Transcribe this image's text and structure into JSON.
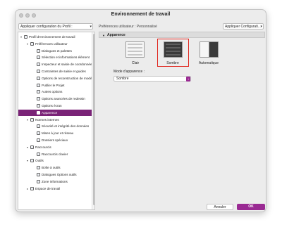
{
  "window": {
    "title": "Environnement de travail"
  },
  "toolbar": {
    "left_select": "Appliquer configuration du Profil :",
    "pref_label": "Préférences utilisateur : Personnalisé",
    "right_select": "Appliquer Configurati..."
  },
  "tree": [
    {
      "label": "Profil d'environnement de travail",
      "level": 0,
      "chevron": "v",
      "icon": "folder-icon"
    },
    {
      "label": "Préférences utilisateur",
      "level": 1,
      "chevron": "v",
      "icon": "folder-icon"
    },
    {
      "label": "Dialogues et palettes",
      "level": 2,
      "icon": "dialog-icon"
    },
    {
      "label": "Sélection et informations élément",
      "level": 2,
      "icon": "selection-icon"
    },
    {
      "label": "Inspecteur et saisie de coordonnées",
      "level": 2,
      "icon": "inspector-icon"
    },
    {
      "label": "Contraintes de saisie et guides",
      "level": 2,
      "icon": "constraint-icon"
    },
    {
      "label": "Options de reconstruction de modèle",
      "level": 2,
      "icon": "rebuild-icon"
    },
    {
      "label": "Publier le Projet",
      "level": 2,
      "icon": "publish-icon"
    },
    {
      "label": "Autres options",
      "level": 2,
      "icon": "options-icon"
    },
    {
      "label": "Options avancées de redessin",
      "level": 2,
      "icon": "redraw-icon"
    },
    {
      "label": "Options écran",
      "level": 2,
      "icon": "screen-icon"
    },
    {
      "label": "Apparence",
      "level": 2,
      "icon": "appearance-icon",
      "active": true
    },
    {
      "label": "Normes internes",
      "level": 1,
      "chevron": "v",
      "icon": "folder-icon"
    },
    {
      "label": "Sécurité et intégrité des données",
      "level": 2,
      "icon": "security-icon"
    },
    {
      "label": "Mises à jour et réseau",
      "level": 2,
      "icon": "network-icon"
    },
    {
      "label": "Dossiers spéciaux",
      "level": 2,
      "icon": "folders-icon"
    },
    {
      "label": "Raccourcis",
      "level": 1,
      "chevron": "v",
      "icon": "shortcut-icon"
    },
    {
      "label": "Raccourcis clavier",
      "level": 2,
      "icon": "keyboard-icon"
    },
    {
      "label": "Outils",
      "level": 1,
      "chevron": "v",
      "icon": "tools-icon"
    },
    {
      "label": "Boîte à outils",
      "level": 2,
      "icon": "toolbox-icon"
    },
    {
      "label": "Dialogues Options outils",
      "level": 2,
      "icon": "tool-options-icon"
    },
    {
      "label": "Zone informations",
      "level": 2,
      "icon": "info-icon"
    },
    {
      "label": "Espace de travail",
      "level": 1,
      "chevron": ">",
      "icon": "workspace-icon"
    }
  ],
  "section": {
    "title": "Apparence"
  },
  "themes": [
    {
      "label": "Clair",
      "kind": "light",
      "selected": false
    },
    {
      "label": "Sombre",
      "kind": "dark",
      "selected": true
    },
    {
      "label": "Automatique",
      "kind": "auto",
      "selected": false
    }
  ],
  "mode": {
    "label": "Mode d'apparence :",
    "value": "Sombre"
  },
  "buttons": {
    "cancel": "Annuler",
    "ok": "OK"
  },
  "colors": {
    "accent": "#9a2a93",
    "selection_ring": "#e0271f"
  }
}
